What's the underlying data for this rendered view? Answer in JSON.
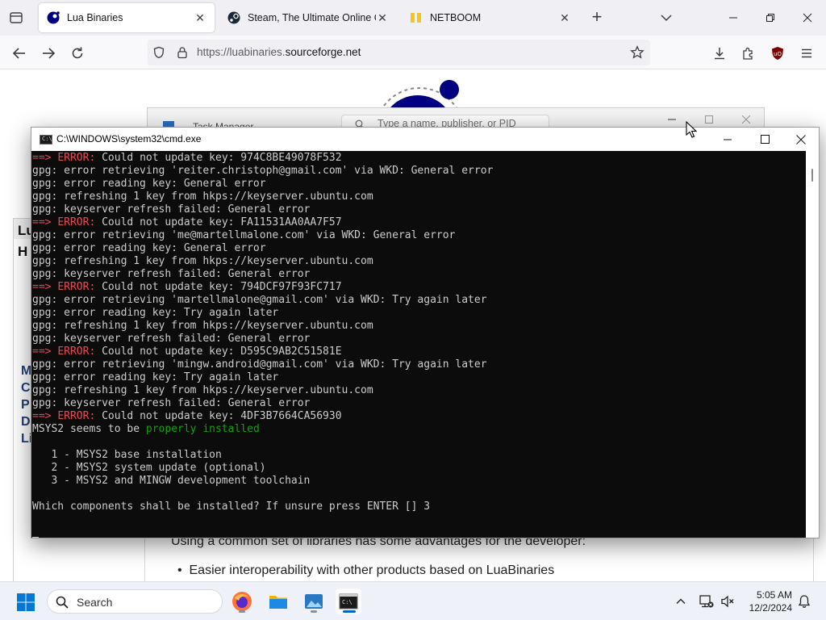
{
  "browser": {
    "tabs": [
      {
        "title": "Lua Binaries",
        "active": true,
        "favicon": "lua-favicon-icon"
      },
      {
        "title": "Steam, The Ultimate Online Game Platform",
        "active": false,
        "favicon": "steam-favicon-icon"
      },
      {
        "title": "NETBOOM",
        "active": false,
        "favicon": "netboom-favicon-icon"
      }
    ],
    "url_prefix": "https://luabinaries.",
    "url_host": "sourceforge.net"
  },
  "webpage": {
    "paragraph": "Using a common set of libraries has some advantages for the developer:",
    "bullet_1": "Easier interoperability with other products based on LuaBinaries",
    "sidebar_letters": [
      "Lu",
      "H",
      "M",
      "C",
      "P",
      "D",
      "Li"
    ]
  },
  "task_manager": {
    "title": "Task Manager",
    "search_placeholder": "Type a name, publisher, or PID"
  },
  "cmd": {
    "title": "C:\\WINDOWS\\system32\\cmd.exe",
    "lines": [
      [
        {
          "t": "==> ",
          "c": "red"
        },
        {
          "t": "ERROR: ",
          "c": "red"
        },
        {
          "t": "Could not update key: 974C8BE49078F532"
        }
      ],
      [
        {
          "t": "gpg: error retrieving 'reiter.christoph@gmail.com' via WKD: General error"
        }
      ],
      [
        {
          "t": "gpg: error reading key: General error"
        }
      ],
      [
        {
          "t": "gpg: refreshing 1 key from hkps://keyserver.ubuntu.com"
        }
      ],
      [
        {
          "t": "gpg: keyserver refresh failed: General error"
        }
      ],
      [
        {
          "t": "==> ",
          "c": "red"
        },
        {
          "t": "ERROR: ",
          "c": "red"
        },
        {
          "t": "Could not update key: FA11531AA0AA7F57"
        }
      ],
      [
        {
          "t": "gpg: error retrieving 'me@martellmalone.com' via WKD: General error"
        }
      ],
      [
        {
          "t": "gpg: error reading key: General error"
        }
      ],
      [
        {
          "t": "gpg: refreshing 1 key from hkps://keyserver.ubuntu.com"
        }
      ],
      [
        {
          "t": "gpg: keyserver refresh failed: General error"
        }
      ],
      [
        {
          "t": "==> ",
          "c": "red"
        },
        {
          "t": "ERROR: ",
          "c": "red"
        },
        {
          "t": "Could not update key: 794DCF97F93FC717"
        }
      ],
      [
        {
          "t": "gpg: error retrieving 'martellmalone@gmail.com' via WKD: Try again later"
        }
      ],
      [
        {
          "t": "gpg: error reading key: Try again later"
        }
      ],
      [
        {
          "t": "gpg: refreshing 1 key from hkps://keyserver.ubuntu.com"
        }
      ],
      [
        {
          "t": "gpg: keyserver refresh failed: General error"
        }
      ],
      [
        {
          "t": "==> ",
          "c": "red"
        },
        {
          "t": "ERROR: ",
          "c": "red"
        },
        {
          "t": "Could not update key: D595C9AB2C51581E"
        }
      ],
      [
        {
          "t": "gpg: error retrieving 'mingw.android@gmail.com' via WKD: Try again later"
        }
      ],
      [
        {
          "t": "gpg: error reading key: Try again later"
        }
      ],
      [
        {
          "t": "gpg: refreshing 1 key from hkps://keyserver.ubuntu.com"
        }
      ],
      [
        {
          "t": "gpg: keyserver refresh failed: General error"
        }
      ],
      [
        {
          "t": "==> ",
          "c": "red"
        },
        {
          "t": "ERROR: ",
          "c": "red"
        },
        {
          "t": "Could not update key: 4DF3B7664CA56930"
        }
      ],
      [
        {
          "t": "MSYS2 seems to be "
        },
        {
          "t": "properly installed",
          "c": "green"
        }
      ],
      [
        {
          "t": ""
        }
      ],
      [
        {
          "t": "   1 - MSYS2 base installation"
        }
      ],
      [
        {
          "t": "   2 - MSYS2 system update (optional)"
        }
      ],
      [
        {
          "t": "   3 - MSYS2 and MINGW development toolchain"
        }
      ],
      [
        {
          "t": ""
        }
      ],
      [
        {
          "t": "Which components shall be installed? If unsure press ENTER [] 3"
        }
      ],
      [
        {
          "t": ""
        }
      ],
      [
        {
          "t": "",
          "cursor": true
        }
      ]
    ]
  },
  "taskbar": {
    "search_label": "Search",
    "time": "5:05 AM",
    "date": "12/2/2024",
    "apps": [
      "firefox-icon",
      "file-explorer-icon",
      "photos-icon",
      "terminal-icon"
    ]
  },
  "colors": {
    "terminal_bg": "#0c0c0c",
    "terminal_text": "#cccccc",
    "error_red": "#e74856",
    "success_green": "#13a10e",
    "accent": "#0067c0"
  }
}
